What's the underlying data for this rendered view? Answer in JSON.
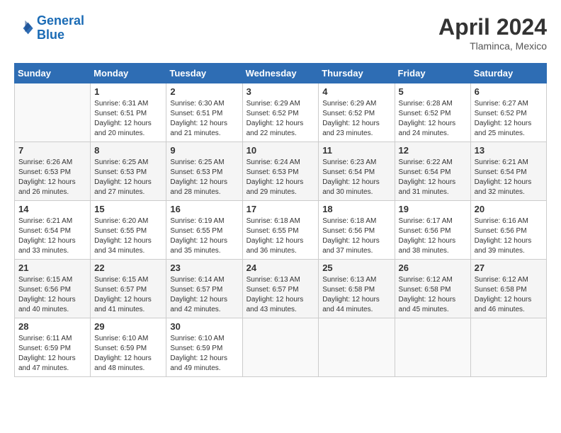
{
  "header": {
    "logo_line1": "General",
    "logo_line2": "Blue",
    "month": "April 2024",
    "location": "Tlaminca, Mexico"
  },
  "columns": [
    "Sunday",
    "Monday",
    "Tuesday",
    "Wednesday",
    "Thursday",
    "Friday",
    "Saturday"
  ],
  "weeks": [
    [
      {
        "day": "",
        "info": ""
      },
      {
        "day": "1",
        "info": "Sunrise: 6:31 AM\nSunset: 6:51 PM\nDaylight: 12 hours\nand 20 minutes."
      },
      {
        "day": "2",
        "info": "Sunrise: 6:30 AM\nSunset: 6:51 PM\nDaylight: 12 hours\nand 21 minutes."
      },
      {
        "day": "3",
        "info": "Sunrise: 6:29 AM\nSunset: 6:52 PM\nDaylight: 12 hours\nand 22 minutes."
      },
      {
        "day": "4",
        "info": "Sunrise: 6:29 AM\nSunset: 6:52 PM\nDaylight: 12 hours\nand 23 minutes."
      },
      {
        "day": "5",
        "info": "Sunrise: 6:28 AM\nSunset: 6:52 PM\nDaylight: 12 hours\nand 24 minutes."
      },
      {
        "day": "6",
        "info": "Sunrise: 6:27 AM\nSunset: 6:52 PM\nDaylight: 12 hours\nand 25 minutes."
      }
    ],
    [
      {
        "day": "7",
        "info": "Sunrise: 6:26 AM\nSunset: 6:53 PM\nDaylight: 12 hours\nand 26 minutes."
      },
      {
        "day": "8",
        "info": "Sunrise: 6:25 AM\nSunset: 6:53 PM\nDaylight: 12 hours\nand 27 minutes."
      },
      {
        "day": "9",
        "info": "Sunrise: 6:25 AM\nSunset: 6:53 PM\nDaylight: 12 hours\nand 28 minutes."
      },
      {
        "day": "10",
        "info": "Sunrise: 6:24 AM\nSunset: 6:53 PM\nDaylight: 12 hours\nand 29 minutes."
      },
      {
        "day": "11",
        "info": "Sunrise: 6:23 AM\nSunset: 6:54 PM\nDaylight: 12 hours\nand 30 minutes."
      },
      {
        "day": "12",
        "info": "Sunrise: 6:22 AM\nSunset: 6:54 PM\nDaylight: 12 hours\nand 31 minutes."
      },
      {
        "day": "13",
        "info": "Sunrise: 6:21 AM\nSunset: 6:54 PM\nDaylight: 12 hours\nand 32 minutes."
      }
    ],
    [
      {
        "day": "14",
        "info": "Sunrise: 6:21 AM\nSunset: 6:54 PM\nDaylight: 12 hours\nand 33 minutes."
      },
      {
        "day": "15",
        "info": "Sunrise: 6:20 AM\nSunset: 6:55 PM\nDaylight: 12 hours\nand 34 minutes."
      },
      {
        "day": "16",
        "info": "Sunrise: 6:19 AM\nSunset: 6:55 PM\nDaylight: 12 hours\nand 35 minutes."
      },
      {
        "day": "17",
        "info": "Sunrise: 6:18 AM\nSunset: 6:55 PM\nDaylight: 12 hours\nand 36 minutes."
      },
      {
        "day": "18",
        "info": "Sunrise: 6:18 AM\nSunset: 6:56 PM\nDaylight: 12 hours\nand 37 minutes."
      },
      {
        "day": "19",
        "info": "Sunrise: 6:17 AM\nSunset: 6:56 PM\nDaylight: 12 hours\nand 38 minutes."
      },
      {
        "day": "20",
        "info": "Sunrise: 6:16 AM\nSunset: 6:56 PM\nDaylight: 12 hours\nand 39 minutes."
      }
    ],
    [
      {
        "day": "21",
        "info": "Sunrise: 6:15 AM\nSunset: 6:56 PM\nDaylight: 12 hours\nand 40 minutes."
      },
      {
        "day": "22",
        "info": "Sunrise: 6:15 AM\nSunset: 6:57 PM\nDaylight: 12 hours\nand 41 minutes."
      },
      {
        "day": "23",
        "info": "Sunrise: 6:14 AM\nSunset: 6:57 PM\nDaylight: 12 hours\nand 42 minutes."
      },
      {
        "day": "24",
        "info": "Sunrise: 6:13 AM\nSunset: 6:57 PM\nDaylight: 12 hours\nand 43 minutes."
      },
      {
        "day": "25",
        "info": "Sunrise: 6:13 AM\nSunset: 6:58 PM\nDaylight: 12 hours\nand 44 minutes."
      },
      {
        "day": "26",
        "info": "Sunrise: 6:12 AM\nSunset: 6:58 PM\nDaylight: 12 hours\nand 45 minutes."
      },
      {
        "day": "27",
        "info": "Sunrise: 6:12 AM\nSunset: 6:58 PM\nDaylight: 12 hours\nand 46 minutes."
      }
    ],
    [
      {
        "day": "28",
        "info": "Sunrise: 6:11 AM\nSunset: 6:59 PM\nDaylight: 12 hours\nand 47 minutes."
      },
      {
        "day": "29",
        "info": "Sunrise: 6:10 AM\nSunset: 6:59 PM\nDaylight: 12 hours\nand 48 minutes."
      },
      {
        "day": "30",
        "info": "Sunrise: 6:10 AM\nSunset: 6:59 PM\nDaylight: 12 hours\nand 49 minutes."
      },
      {
        "day": "",
        "info": ""
      },
      {
        "day": "",
        "info": ""
      },
      {
        "day": "",
        "info": ""
      },
      {
        "day": "",
        "info": ""
      }
    ]
  ]
}
